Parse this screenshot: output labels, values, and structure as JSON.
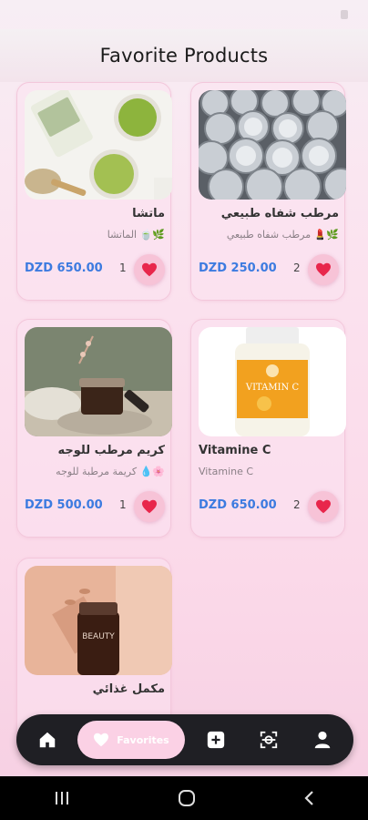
{
  "status_bar": {
    "time": ""
  },
  "header": {
    "title": "Favorite Products"
  },
  "products": [
    {
      "name": "ماتشا",
      "description": "🌿🍵 الماتشا",
      "price": "DZD 650.00",
      "quantity": "1",
      "favorited": true
    },
    {
      "name": "مرطب شفاه طبيعي",
      "description": "🌿💄 مرطب شفاه طبيعي",
      "price": "DZD 250.00",
      "quantity": "2",
      "favorited": true
    },
    {
      "name": "كريم مرطب للوجه",
      "description": "🌸💧 كريمة مرطبة للوجه",
      "price": "DZD 500.00",
      "quantity": "1",
      "favorited": true
    },
    {
      "name": "Vitamine C",
      "description": "Vitamine C",
      "price": "DZD 650.00",
      "quantity": "2",
      "favorited": true
    },
    {
      "name": "مكمل غذائي",
      "description": "",
      "price": "",
      "quantity": "",
      "favorited": true
    }
  ],
  "image_labels": {
    "vitamin_c": "VITAMIN C",
    "beauty": "BEAUTY"
  },
  "bottom_nav": {
    "active_label": "Favorites",
    "items": [
      "home-icon",
      "heart-icon",
      "add-icon",
      "scan-icon",
      "profile-icon"
    ]
  },
  "colors": {
    "accent": "#fbd1e5",
    "price": "#3c7be0",
    "heart": "#e8264b",
    "nav_bg": "#1f1f24"
  }
}
